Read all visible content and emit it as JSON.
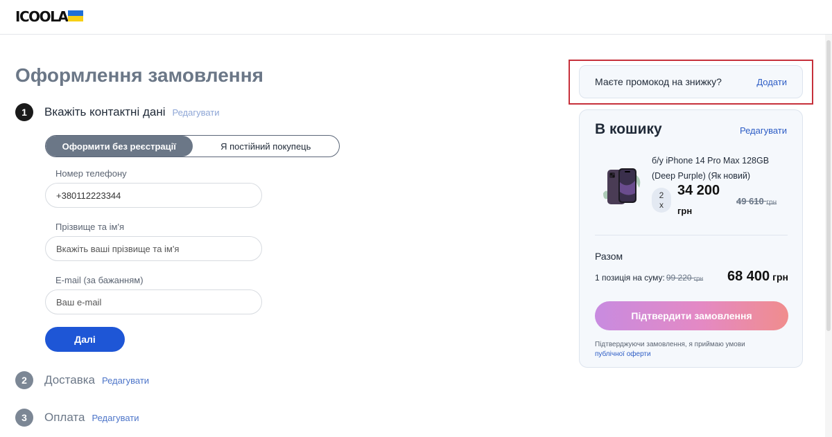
{
  "header": {
    "logo_text": "ICOOLA",
    "flag_colors": [
      "#1f6fd6",
      "#f7cf15"
    ]
  },
  "page": {
    "title": "Оформлення замовлення"
  },
  "steps": [
    {
      "number": "1",
      "title": "Вкажіть контактні дані",
      "edit": "Редагувати"
    },
    {
      "number": "2",
      "title": "Доставка",
      "edit": "Редагувати"
    },
    {
      "number": "3",
      "title": "Оплата",
      "edit": "Редагувати"
    }
  ],
  "toggle": {
    "guest": "Оформити без реєстрації",
    "returning": "Я постійний покупець"
  },
  "form": {
    "phone_label": "Номер телефону",
    "phone_value": "+380112223344",
    "name_label": "Прізвище та ім'я",
    "name_placeholder": "Вкажіть ваші прізвище та ім'я",
    "email_label": "E-mail (за бажанням)",
    "email_placeholder": "Ваш e-mail",
    "next_button": "Далі"
  },
  "promo": {
    "text": "Маєте промокод на знижку?",
    "add": "Додати",
    "highlight_color": "#c6303a"
  },
  "cart": {
    "title": "В кошику",
    "edit": "Редагувати",
    "item": {
      "name": "б/у iPhone 14 Pro Max 128GB (Deep Purple) (Як новий)",
      "qty_num": "2",
      "qty_x": "x",
      "price": "34 200",
      "currency": "грн",
      "old_price": "49 610",
      "old_currency": "грн"
    },
    "total_label": "Разом",
    "total_desc": "1 позиція на суму:",
    "total_old": "99 220",
    "total_old_currency": "грн",
    "total_new": "68 400",
    "total_new_currency": "грн",
    "confirm_button": "Підтвердити замовлення",
    "terms_text": "Підтверджуючи замовлення, я приймаю умови",
    "terms_link": "публічної оферти",
    "confirm_gradient": [
      "#c88be0",
      "#e489c4",
      "#f08d8d"
    ]
  }
}
